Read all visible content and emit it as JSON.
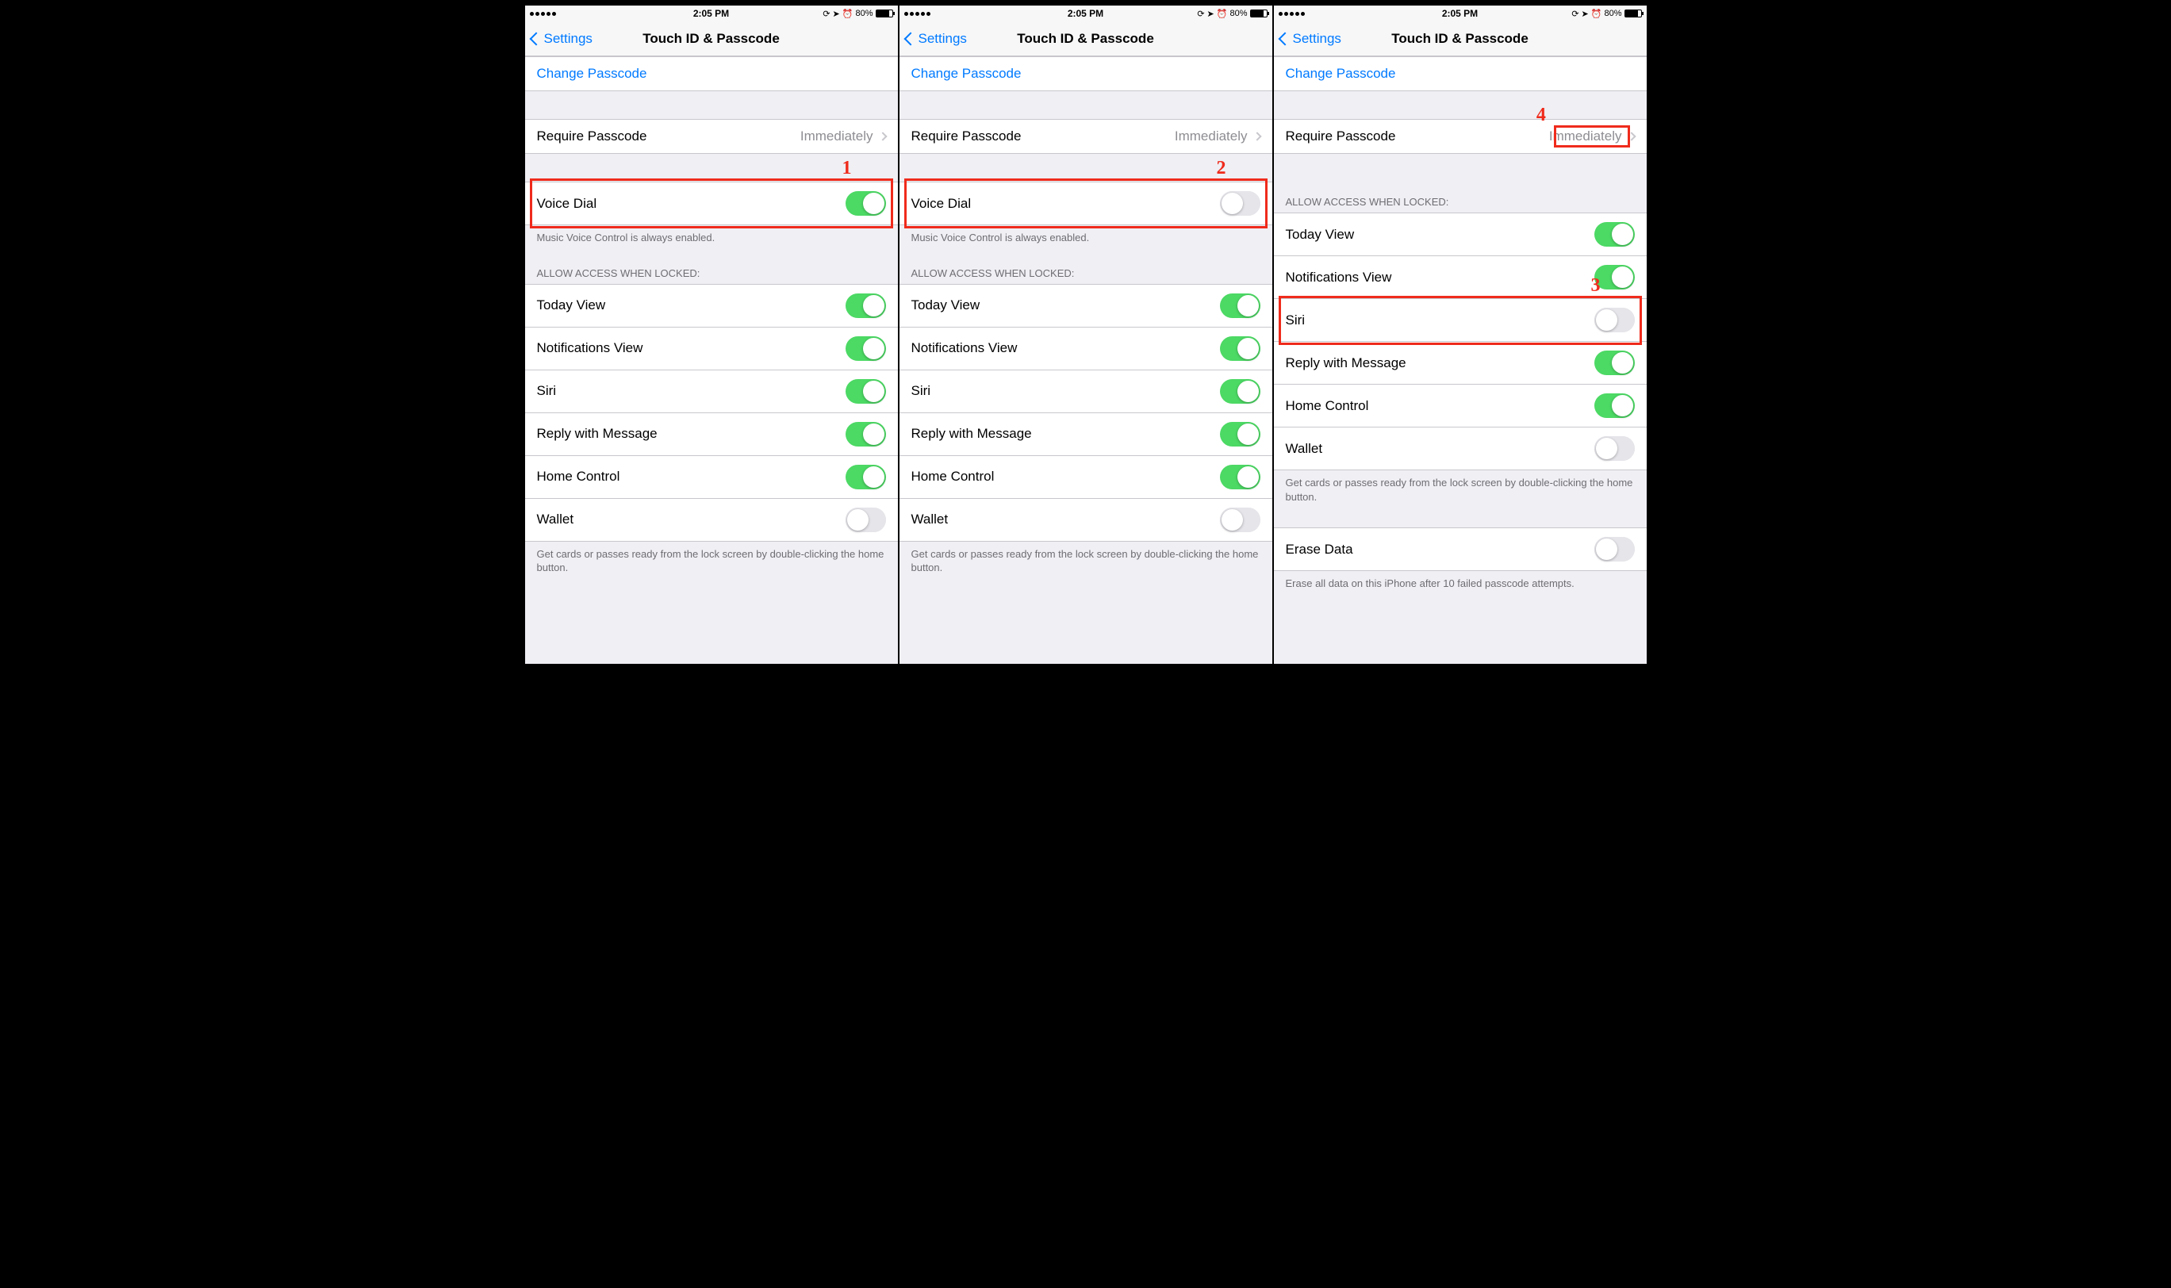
{
  "statusbar": {
    "time": "2:05 PM",
    "battery_pct": "80%"
  },
  "nav": {
    "back_label": "Settings",
    "title": "Touch ID & Passcode"
  },
  "cells": {
    "change_passcode": "Change Passcode",
    "require_passcode": "Require Passcode",
    "require_passcode_value": "Immediately",
    "voice_dial": "Voice Dial",
    "voice_dial_footer": "Music Voice Control is always enabled.",
    "allow_header": "ALLOW ACCESS WHEN LOCKED:",
    "today_view": "Today View",
    "notifications_view": "Notifications View",
    "siri": "Siri",
    "reply_with_message": "Reply with Message",
    "home_control": "Home Control",
    "wallet": "Wallet",
    "wallet_footer": "Get cards or passes ready from the lock screen by double-clicking the home button.",
    "erase_data": "Erase Data",
    "erase_footer": "Erase all data on this iPhone after 10 failed passcode attempts."
  },
  "screens": [
    {
      "voice_dial_on": true,
      "show_voice_dial": true,
      "toggles": {
        "today": true,
        "notif": true,
        "siri": true,
        "reply": true,
        "home": true,
        "wallet": false
      },
      "annot_num": "1",
      "annot_target": "voice-dial",
      "num_pos": "right"
    },
    {
      "voice_dial_on": false,
      "show_voice_dial": true,
      "toggles": {
        "today": true,
        "notif": true,
        "siri": true,
        "reply": true,
        "home": true,
        "wallet": false
      },
      "annot_num": "2",
      "annot_target": "voice-dial",
      "num_pos": "right"
    },
    {
      "show_voice_dial": false,
      "toggles": {
        "today": true,
        "notif": true,
        "siri": false,
        "reply": true,
        "home": true,
        "wallet": false
      },
      "annot_num": "3",
      "annot_target": "siri",
      "num_pos": "right",
      "second_annot_num": "4",
      "second_annot_target": "require-value",
      "show_erase": true
    }
  ]
}
